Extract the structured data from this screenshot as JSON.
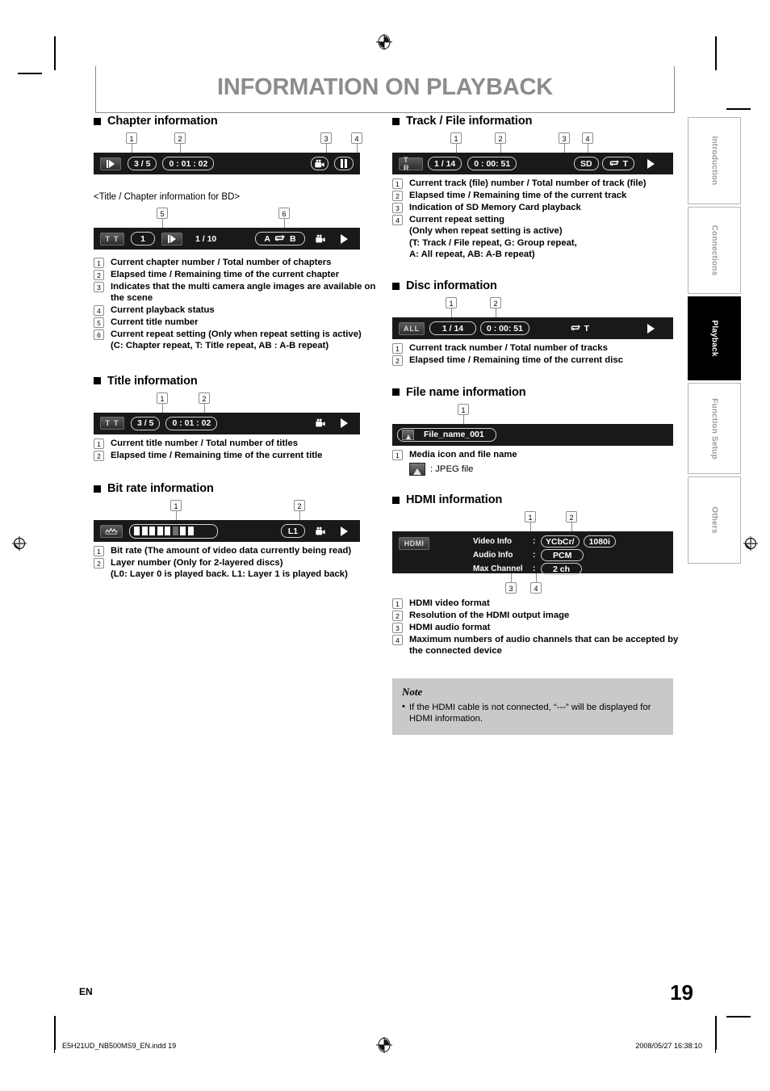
{
  "page": {
    "title": "INFORMATION ON PLAYBACK",
    "language_code": "EN",
    "page_number": "19",
    "print_file": "E5H21UD_NB500MS9_EN.indd   19",
    "print_date": "2008/05/27   16:38:10"
  },
  "side_tabs": [
    {
      "label": "Introduction",
      "active": false
    },
    {
      "label": "Connections",
      "active": false
    },
    {
      "label": "Playback",
      "active": true
    },
    {
      "label": "Function Setup",
      "active": false
    },
    {
      "label": "Others",
      "active": false
    }
  ],
  "sections": {
    "chapter_information": {
      "heading": "Chapter information",
      "subheading": "<Title / Chapter information for BD>",
      "osd_chapter": {
        "mode_icon": "play-chapter-icon",
        "chapter_counter": "3 / 5",
        "time": "0 : 01 : 02",
        "angle_icon": "camera-angle-icon",
        "status_icon": "pause-icon"
      },
      "osd_bd": {
        "title_tag": "T T",
        "title_number": "1",
        "chapter_icon": "play-chapter-icon",
        "chapter_counter": "1 / 10",
        "repeat": "A ↺ B",
        "repeat_left": "A",
        "repeat_right": "B",
        "angle_icon": "camera-angle-icon",
        "status_icon": "play-icon"
      },
      "callouts": [
        "1",
        "2",
        "3",
        "4",
        "5",
        "6"
      ],
      "descriptions": [
        {
          "n": "1",
          "text": "Current chapter number / Total number of chapters"
        },
        {
          "n": "2",
          "text": "Elapsed time / Remaining time of the current chapter"
        },
        {
          "n": "3",
          "text": "Indicates that the multi camera angle images are available on the scene"
        },
        {
          "n": "4",
          "text": "Current playback status"
        },
        {
          "n": "5",
          "text": "Current title number"
        },
        {
          "n": "6",
          "text": "Current repeat setting (Only when repeat setting is active)\n(C: Chapter repeat, T: Title repeat, AB : A-B repeat)"
        }
      ]
    },
    "title_information": {
      "heading": "Title information",
      "osd": {
        "title_tag": "T T",
        "title_counter": "3 / 5",
        "time": "0 : 01 : 02",
        "angle_icon": "camera-angle-icon",
        "status_icon": "play-icon"
      },
      "descriptions": [
        {
          "n": "1",
          "text": "Current title number / Total number of titles"
        },
        {
          "n": "2",
          "text": "Elapsed time / Remaining time of the current title"
        }
      ]
    },
    "bit_rate_information": {
      "heading": "Bit rate information",
      "osd": {
        "meter_icon": "bitrate-graph-icon",
        "meter_segments_total": 8,
        "meter_segments_lit": 5,
        "layer": "L1",
        "angle_icon": "camera-angle-icon",
        "status_icon": "play-icon"
      },
      "descriptions": [
        {
          "n": "1",
          "text": "Bit rate (The amount of video data currently being read)"
        },
        {
          "n": "2",
          "text": "Layer number (Only for 2-layered discs)\n(L0: Layer 0 is played back. L1: Layer 1 is played back)"
        }
      ]
    },
    "track_file_information": {
      "heading": "Track / File information",
      "osd": {
        "track_tag": "T R",
        "track_counter": "1 / 14",
        "time": "0 : 00: 51",
        "media": "SD",
        "repeat": "T",
        "status_icon": "play-icon"
      },
      "descriptions": [
        {
          "n": "1",
          "text": "Current track (file) number / Total number of track (file)"
        },
        {
          "n": "2",
          "text": "Elapsed time / Remaining time of the current track"
        },
        {
          "n": "3",
          "text": "Indication of SD Memory Card playback"
        },
        {
          "n": "4",
          "text": "Current repeat setting\n(Only when repeat setting is active)\n(T: Track / File repeat, G: Group repeat,\nA: All repeat, AB: A-B repeat)"
        }
      ]
    },
    "disc_information": {
      "heading": "Disc information",
      "osd": {
        "all_tag": "ALL",
        "track_counter": "1 / 14",
        "time": "0 : 00: 51",
        "repeat": "T",
        "status_icon": "play-icon"
      },
      "descriptions": [
        {
          "n": "1",
          "text": "Current track number / Total number of tracks"
        },
        {
          "n": "2",
          "text": "Elapsed time / Remaining time of the current disc"
        }
      ]
    },
    "file_name_information": {
      "heading": "File name information",
      "osd": {
        "media_icon": "jpeg-file-icon",
        "file_name": "File_name_001"
      },
      "descriptions": [
        {
          "n": "1",
          "text": "Media icon and file name"
        }
      ],
      "legend": ": JPEG file"
    },
    "hdmi_information": {
      "heading": "HDMI information",
      "osd": {
        "hdmi_tag": "HDMI",
        "rows": [
          {
            "label": "Video Info",
            "colon": ":",
            "values": [
              "YCbCr/",
              "1080i"
            ]
          },
          {
            "label": "Audio Info",
            "colon": ":",
            "values": [
              "PCM"
            ]
          },
          {
            "label": "Max Channel",
            "colon": ":",
            "values": [
              "2 ch"
            ]
          }
        ]
      },
      "descriptions": [
        {
          "n": "1",
          "text": "HDMI video format"
        },
        {
          "n": "2",
          "text": "Resolution of the HDMI output image"
        },
        {
          "n": "3",
          "text": "HDMI audio format"
        },
        {
          "n": "4",
          "text": "Maximum numbers of audio channels that can be accepted by the connected device"
        }
      ]
    }
  },
  "note": {
    "title": "Note",
    "items": [
      "If the HDMI cable is not connected, “---” will be displayed for HDMI information."
    ]
  },
  "colors": {
    "title_gray": "#8c8c8c",
    "osd_black": "#191919",
    "note_gray": "#c9c9c9",
    "tab_inactive_text": "#9c9c9c"
  }
}
